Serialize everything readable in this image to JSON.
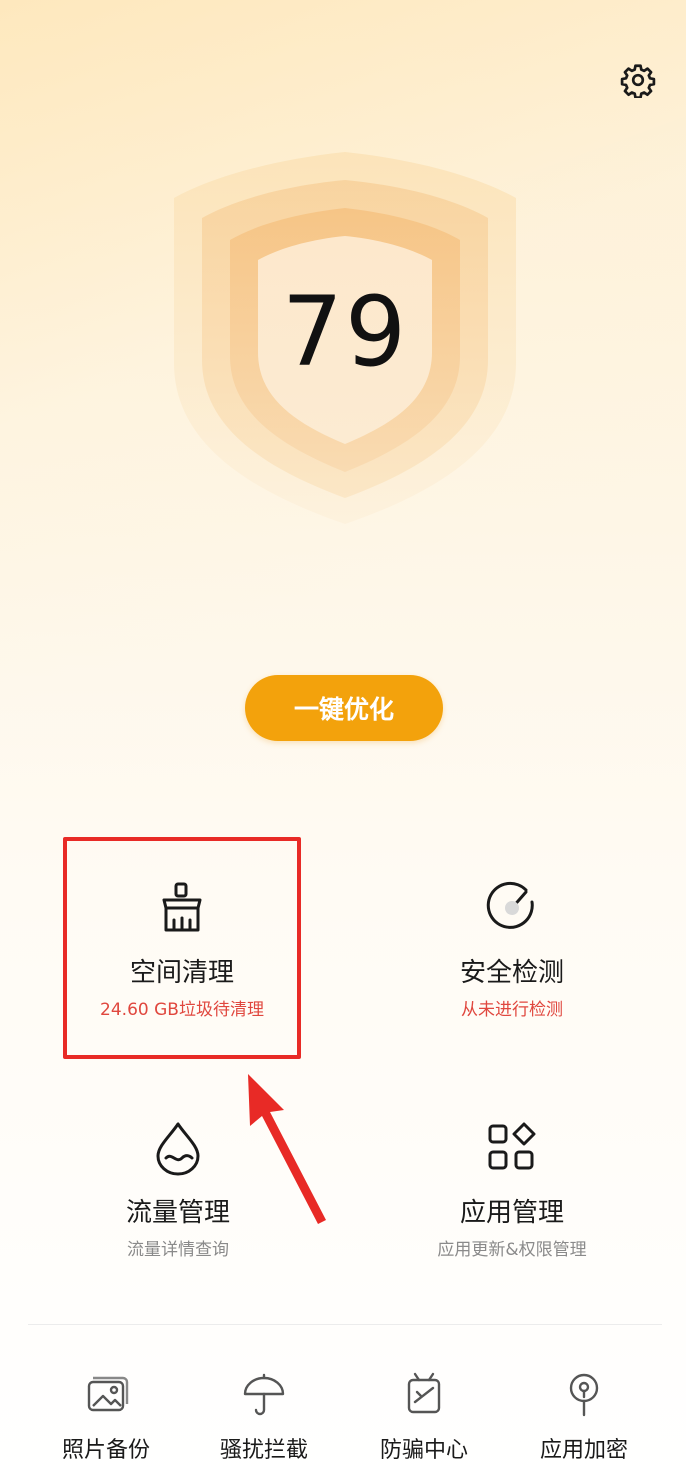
{
  "header": {
    "settings_icon": "gear-icon"
  },
  "score": {
    "value": "79",
    "shield_icon": "shield-icon"
  },
  "optimize": {
    "label": "一键优化",
    "color": "#f3a20c"
  },
  "tiles": [
    {
      "title": "空间清理",
      "subtitle": "24.60 GB垃圾待清理",
      "icon": "broom-icon",
      "subtitle_color": "#e0473e"
    },
    {
      "title": "安全检测",
      "subtitle": "从未进行检测",
      "icon": "gauge-icon",
      "subtitle_color": "#e0473e"
    },
    {
      "title": "流量管理",
      "subtitle": "流量详情查询",
      "icon": "water-drop-icon"
    },
    {
      "title": "应用管理",
      "subtitle": "应用更新&权限管理",
      "icon": "apps-grid-icon"
    }
  ],
  "annotation": {
    "highlight_color": "#e82a26"
  },
  "dock": [
    {
      "label": "照片备份",
      "icon": "photo-icon"
    },
    {
      "label": "骚扰拦截",
      "icon": "umbrella-icon"
    },
    {
      "label": "防骗中心",
      "icon": "shield-check-icon"
    },
    {
      "label": "应用加密",
      "icon": "lock-pin-icon"
    }
  ]
}
